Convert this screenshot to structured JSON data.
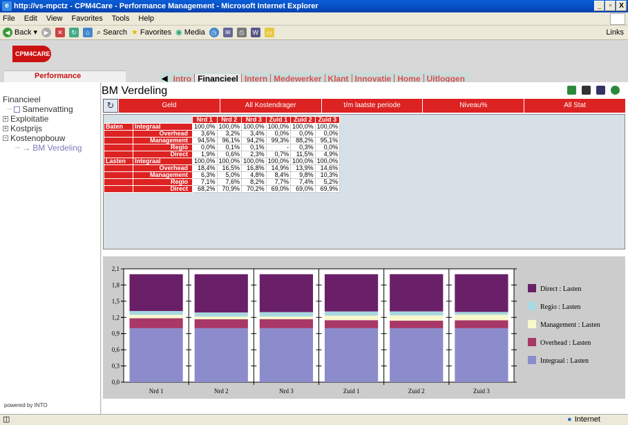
{
  "window": {
    "title": "http://vs-mpctz - CPM4Care - Performance Management - Microsoft Internet Explorer",
    "controls": [
      "_",
      "▫",
      "X"
    ]
  },
  "menu": [
    "File",
    "Edit",
    "View",
    "Favorites",
    "Tools",
    "Help"
  ],
  "toolbar": {
    "back": "Back",
    "search": "Search",
    "favorites": "Favorites",
    "media": "Media",
    "links": "Links"
  },
  "banner": {
    "logo_text": "CPM4CARE",
    "subtitle": "Performance Management"
  },
  "nav": {
    "items": [
      {
        "label": "Intro"
      },
      {
        "label": "Financieel",
        "active": true
      },
      {
        "label": "Intern"
      },
      {
        "label": "Medewerker"
      },
      {
        "label": "Klant"
      },
      {
        "label": "Innovatie"
      },
      {
        "label": "Home"
      },
      {
        "label": "Uitloggen"
      }
    ]
  },
  "sidebar": {
    "heading": "Financieel",
    "items": [
      {
        "label": "Samenvatting",
        "marker": "sq"
      },
      {
        "label": "Exploitatie",
        "marker": "+"
      },
      {
        "label": "Kostprijs",
        "marker": "+"
      },
      {
        "label": "Kostenopbouw",
        "marker": "−"
      },
      {
        "label": "BM Verdeling",
        "marker": "→"
      }
    ],
    "powered_by": "powered by INTO"
  },
  "page": {
    "title": "BM Verdeling"
  },
  "filters": [
    "Geld",
    "All Kostendrager",
    "t/m laatste periode",
    "Niveau%",
    "All Stat"
  ],
  "table": {
    "columns": [
      "Nrd 1",
      "Nrd 2",
      "Nrd 3",
      "Zuid 1",
      "Zuid 2",
      "Zuid 3"
    ],
    "rows": [
      {
        "group": "Baten",
        "label": "Integraal",
        "values": [
          "100,0%",
          "100,0%",
          "100,0%",
          "100,0%",
          "100,0%",
          "100,0%"
        ]
      },
      {
        "group": "",
        "label": "Overhead",
        "values": [
          "3,6%",
          "3,2%",
          "3,4%",
          "0,0%",
          "0,0%",
          "0,0%"
        ]
      },
      {
        "group": "",
        "label": "Management",
        "values": [
          "94,5%",
          "96,1%",
          "94,2%",
          "99,3%",
          "88,2%",
          "95,1%"
        ]
      },
      {
        "group": "",
        "label": "Regio",
        "values": [
          "0,0%",
          "0,1%",
          "0,1%",
          "-",
          "0,3%",
          "0,0%"
        ]
      },
      {
        "group": "",
        "label": "Direct",
        "values": [
          "1,9%",
          "0,6%",
          "2,3%",
          "0,7%",
          "11,5%",
          "4,9%"
        ]
      },
      {
        "group": "Lasten",
        "label": "Integraal",
        "values": [
          "100,0%",
          "100,0%",
          "100,0%",
          "100,0%",
          "100,0%",
          "100,0%"
        ]
      },
      {
        "group": "",
        "label": "Overhead",
        "values": [
          "18,4%",
          "16,5%",
          "16,8%",
          "14,9%",
          "13,9%",
          "14,6%"
        ]
      },
      {
        "group": "",
        "label": "Management",
        "values": [
          "6,3%",
          "5,0%",
          "4,8%",
          "8,4%",
          "9,8%",
          "10,3%"
        ]
      },
      {
        "group": "",
        "label": "Regio",
        "values": [
          "7,1%",
          "7,6%",
          "8,2%",
          "7,7%",
          "7,4%",
          "5,2%"
        ]
      },
      {
        "group": "",
        "label": "Direct",
        "values": [
          "68,2%",
          "70,9%",
          "70,2%",
          "69,0%",
          "69,0%",
          "69,9%"
        ]
      }
    ]
  },
  "chart_data": {
    "type": "bar",
    "stacked": true,
    "categories": [
      "Nrd 1",
      "Nrd 2",
      "Nrd 3",
      "Zuid 1",
      "Zuid 2",
      "Zuid 3"
    ],
    "ylim": [
      0,
      2.1
    ],
    "yticks": [
      "0,0",
      "0,3",
      "0,6",
      "0,9",
      "1,2",
      "1,5",
      "1,8",
      "2,1"
    ],
    "series": [
      {
        "name": "Integraal : Lasten",
        "color": "#8c8ccc",
        "values": [
          1.0,
          1.0,
          1.0,
          1.0,
          1.0,
          1.0
        ]
      },
      {
        "name": "Overhead : Lasten",
        "color": "#a83868",
        "values": [
          0.184,
          0.165,
          0.168,
          0.149,
          0.139,
          0.146
        ]
      },
      {
        "name": "Management : Lasten",
        "color": "#f8f8cc",
        "values": [
          0.063,
          0.05,
          0.048,
          0.084,
          0.098,
          0.103
        ]
      },
      {
        "name": "Regio : Lasten",
        "color": "#a8d8e0",
        "values": [
          0.071,
          0.076,
          0.082,
          0.077,
          0.074,
          0.052
        ]
      },
      {
        "name": "Direct : Lasten",
        "color": "#6a2068",
        "values": [
          0.682,
          0.709,
          0.702,
          0.69,
          0.69,
          0.699
        ]
      }
    ],
    "legend_order": [
      "Direct : Lasten",
      "Regio : Lasten",
      "Management : Lasten",
      "Overhead : Lasten",
      "Integraal : Lasten"
    ],
    "legend": "right",
    "grid": false
  },
  "status": {
    "zone": "Internet"
  }
}
